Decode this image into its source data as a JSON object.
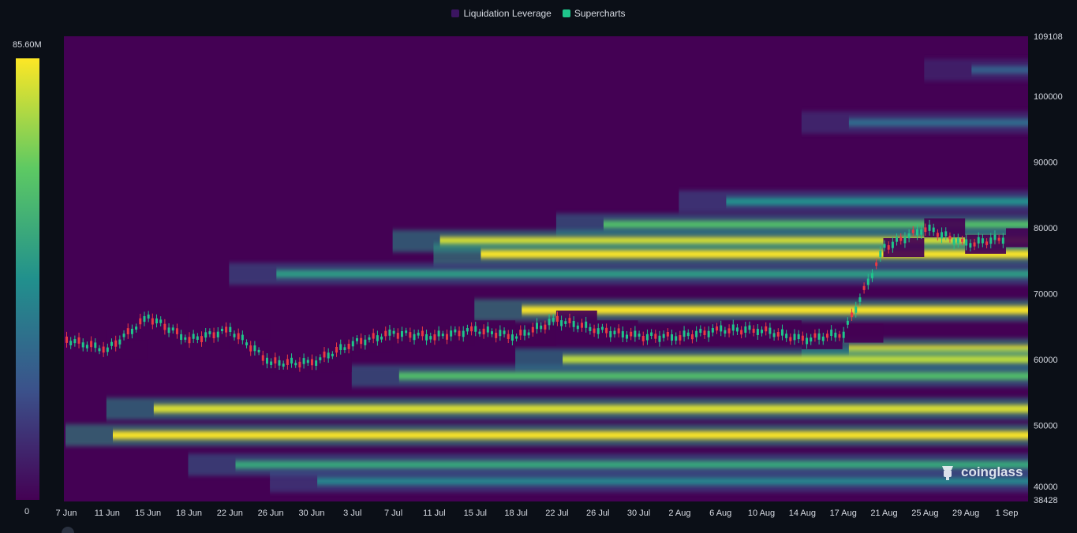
{
  "legend": {
    "items": [
      {
        "label": "Liquidation Leverage",
        "color": "#3b1560"
      },
      {
        "label": "Supercharts",
        "color": "#1fc58b"
      }
    ]
  },
  "watermark": {
    "text": "coinglass"
  },
  "colors": {
    "low": "#440154",
    "mid": "#21908d",
    "high": "#fde725",
    "up_candle": "#1fc58b",
    "down_candle": "#ea3943"
  },
  "chart_data": {
    "type": "heatmap",
    "title": "",
    "color_scale": {
      "min_label": "0",
      "max_label": "85.60M",
      "min": 0,
      "max": 85600000
    },
    "x_ticks": [
      "7 Jun",
      "11 Jun",
      "15 Jun",
      "18 Jun",
      "22 Jun",
      "26 Jun",
      "30 Jun",
      "3 Jul",
      "7 Jul",
      "11 Jul",
      "15 Jul",
      "18 Jul",
      "22 Jul",
      "26 Jul",
      "30 Jul",
      "2 Aug",
      "6 Aug",
      "10 Aug",
      "14 Aug",
      "17 Aug",
      "21 Aug",
      "25 Aug",
      "29 Aug",
      "1 Sep"
    ],
    "y_ticks": [
      "109108",
      "100000",
      "90000",
      "80000",
      "70000",
      "60000",
      "50000",
      "40000",
      "38428"
    ],
    "ylim": [
      38428,
      109108
    ],
    "price_series": {
      "name": "",
      "x": [
        "7 Jun",
        "11 Jun",
        "15 Jun",
        "18 Jun",
        "22 Jun",
        "26 Jun",
        "30 Jun",
        "3 Jul",
        "7 Jul",
        "11 Jul",
        "15 Jul",
        "18 Jul",
        "22 Jul",
        "26 Jul",
        "30 Jul",
        "2 Aug",
        "6 Aug",
        "10 Aug",
        "14 Aug",
        "17 Aug",
        "21 Aug",
        "25 Aug",
        "29 Aug",
        "1 Sep"
      ],
      "values": [
        63000,
        61500,
        66500,
        63000,
        64500,
        59500,
        59500,
        62500,
        64000,
        63500,
        64500,
        63500,
        66000,
        64500,
        63500,
        63500,
        64500,
        64500,
        63000,
        64000,
        77000,
        80000,
        77500,
        78500
      ]
    },
    "bands": [
      {
        "level": 104000,
        "start": "25 Aug",
        "intensity": 0.3
      },
      {
        "level": 96000,
        "start": "14 Aug",
        "intensity": 0.35
      },
      {
        "level": 84000,
        "start": "2 Aug",
        "intensity": 0.5
      },
      {
        "level": 80500,
        "start": "22 Jul",
        "intensity": 0.7
      },
      {
        "level": 78000,
        "start": "7 Jul",
        "intensity": 0.95
      },
      {
        "level": 76000,
        "start": "11 Jul",
        "intensity": 1.0
      },
      {
        "level": 73000,
        "start": "22 Jun",
        "intensity": 0.55
      },
      {
        "level": 67500,
        "start": "15 Jul",
        "intensity": 1.0
      },
      {
        "level": 61500,
        "start": "14 Aug",
        "intensity": 1.0
      },
      {
        "level": 60000,
        "start": "18 Jul",
        "intensity": 0.9
      },
      {
        "level": 57500,
        "start": "3 Jul",
        "intensity": 0.7
      },
      {
        "level": 52500,
        "start": "11 Jun",
        "intensity": 0.95
      },
      {
        "level": 48500,
        "start": "7 Jun",
        "intensity": 1.0
      },
      {
        "level": 44000,
        "start": "18 Jun",
        "intensity": 0.6
      },
      {
        "level": 41500,
        "start": "26 Jun",
        "intensity": 0.45
      }
    ]
  }
}
